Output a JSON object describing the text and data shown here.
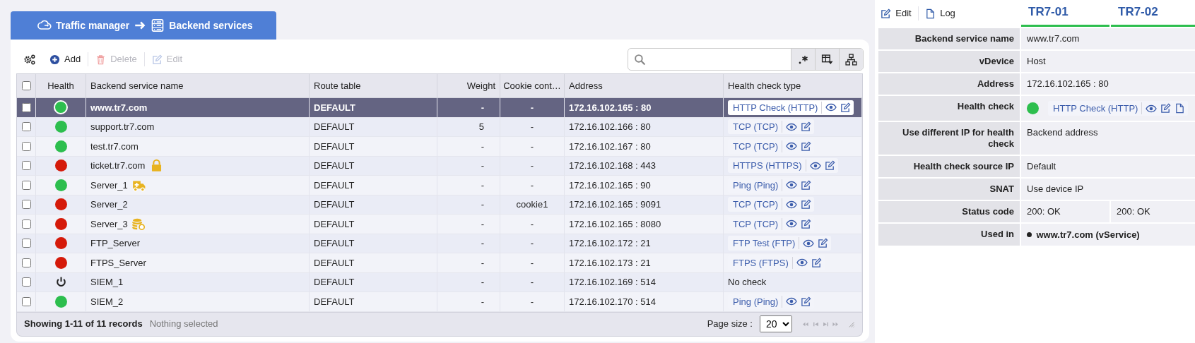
{
  "breadcrumb": [
    {
      "label": "Traffic manager"
    },
    {
      "label": "Backend services"
    }
  ],
  "toolbar": [
    {
      "label": "Add",
      "kind": "add",
      "disabled": false
    },
    {
      "label": "Delete",
      "kind": "delete",
      "disabled": true
    },
    {
      "label": "Edit",
      "kind": "edit",
      "disabled": true
    }
  ],
  "table": {
    "all_checked": false,
    "columns": [
      "Health",
      "Backend service name",
      "Route table",
      "Weight",
      "Cookie cont…",
      "Address",
      "Health check type"
    ],
    "rows": [
      {
        "selected": true,
        "checked": false,
        "health": {
          "kind": "dot",
          "color": "#2dbe4e"
        },
        "name": "www.tr7.com",
        "route": "DEFAULT",
        "weight": "-",
        "cookie": "-",
        "address": "172.16.102.165 : 80",
        "check": {
          "kind": "link",
          "label": "HTTP Check (HTTP)"
        }
      },
      {
        "selected": false,
        "checked": false,
        "health": {
          "kind": "dot",
          "color": "#2dbe4e"
        },
        "name": "support.tr7.com",
        "route": "DEFAULT",
        "weight": "5",
        "cookie": "-",
        "address": "172.16.102.166 : 80",
        "check": {
          "kind": "link",
          "label": "TCP (TCP)"
        }
      },
      {
        "selected": false,
        "checked": false,
        "health": {
          "kind": "dot",
          "color": "#2dbe4e"
        },
        "name": "test.tr7.com",
        "route": "DEFAULT",
        "weight": "-",
        "cookie": "-",
        "address": "172.16.102.167 : 80",
        "check": {
          "kind": "link",
          "label": "TCP (TCP)"
        }
      },
      {
        "selected": false,
        "checked": false,
        "health": {
          "kind": "dot",
          "color": "#d51a0a"
        },
        "name": "ticket.tr7.com",
        "marker": {
          "kind": "lock"
        },
        "route": "DEFAULT",
        "weight": "-",
        "cookie": "-",
        "address": "172.16.102.168 : 443",
        "check": {
          "kind": "link",
          "label": "HTTPS (HTTPS)"
        }
      },
      {
        "selected": false,
        "checked": false,
        "health": {
          "kind": "dot",
          "color": "#2dbe4e"
        },
        "name": "Server_1",
        "marker": {
          "kind": "ambulance"
        },
        "route": "DEFAULT",
        "weight": "-",
        "cookie": "-",
        "address": "172.16.102.165 : 90",
        "check": {
          "kind": "link",
          "label": "Ping (Ping)"
        }
      },
      {
        "selected": false,
        "checked": false,
        "health": {
          "kind": "dot",
          "color": "#d51a0a"
        },
        "name": "Server_2",
        "route": "DEFAULT",
        "weight": "-",
        "cookie": "cookie1",
        "address": "172.16.102.165 : 9091",
        "check": {
          "kind": "link",
          "label": "TCP (TCP)"
        }
      },
      {
        "selected": false,
        "checked": false,
        "health": {
          "kind": "dot",
          "color": "#d51a0a"
        },
        "name": "Server_3",
        "marker": {
          "kind": "coins"
        },
        "route": "DEFAULT",
        "weight": "-",
        "cookie": "-",
        "address": "172.16.102.165 : 8080",
        "check": {
          "kind": "link",
          "label": "TCP (TCP)"
        }
      },
      {
        "selected": false,
        "checked": false,
        "health": {
          "kind": "dot",
          "color": "#d51a0a"
        },
        "name": "FTP_Server",
        "route": "DEFAULT",
        "weight": "-",
        "cookie": "-",
        "address": "172.16.102.172 : 21",
        "check": {
          "kind": "link",
          "label": "FTP Test (FTP)"
        }
      },
      {
        "selected": false,
        "checked": false,
        "health": {
          "kind": "dot",
          "color": "#d51a0a"
        },
        "name": "FTPS_Server",
        "route": "DEFAULT",
        "weight": "-",
        "cookie": "-",
        "address": "172.16.102.173 : 21",
        "check": {
          "kind": "link",
          "label": "FTPS (FTPS)"
        }
      },
      {
        "selected": false,
        "checked": false,
        "health": {
          "kind": "power"
        },
        "name": "SIEM_1",
        "route": "DEFAULT",
        "weight": "-",
        "cookie": "-",
        "address": "172.16.102.169 : 514",
        "check": {
          "kind": "plain",
          "label": "No check"
        }
      },
      {
        "selected": false,
        "checked": false,
        "health": {
          "kind": "dot",
          "color": "#2dbe4e"
        },
        "name": "SIEM_2",
        "route": "DEFAULT",
        "weight": "-",
        "cookie": "-",
        "address": "172.16.102.170 : 514",
        "check": {
          "kind": "link",
          "label": "Ping (Ping)"
        }
      }
    ]
  },
  "footer": {
    "summary": "Showing 1-11 of 11 records",
    "selection": "Nothing selected",
    "page_size_label": "Page size :",
    "page_size": "20"
  },
  "detail": {
    "actions": [
      {
        "label": "Edit",
        "kind": "edit"
      },
      {
        "label": "Log",
        "kind": "log"
      }
    ],
    "devices": [
      {
        "name": "TR7-01",
        "color": "#2dbe4e"
      },
      {
        "name": "TR7-02",
        "color": "#2dbe4e"
      }
    ],
    "rows": [
      {
        "label": "Backend service name",
        "kind": "text",
        "values": [
          "www.tr7.com"
        ]
      },
      {
        "label": "vDevice",
        "kind": "text",
        "values": [
          "Host"
        ]
      },
      {
        "label": "Address",
        "kind": "text",
        "values": [
          "172.16.102.165 : 80"
        ]
      },
      {
        "label": "Health check",
        "kind": "check",
        "health": {
          "kind": "dot",
          "color": "#2dbe4e"
        },
        "check": {
          "kind": "link",
          "label": "HTTP Check (HTTP)"
        }
      },
      {
        "label": "Use different IP for health check",
        "kind": "text",
        "values": [
          "Backend address"
        ]
      },
      {
        "label": "Health check source IP",
        "kind": "text",
        "values": [
          "Default"
        ]
      },
      {
        "label": "SNAT",
        "kind": "text",
        "values": [
          "Use device IP"
        ]
      },
      {
        "label": "Status code",
        "kind": "text",
        "values": [
          "200: OK",
          "200: OK"
        ]
      },
      {
        "label": "Used in",
        "kind": "bullet",
        "values": [
          "www.tr7.com (vService)"
        ]
      }
    ]
  }
}
